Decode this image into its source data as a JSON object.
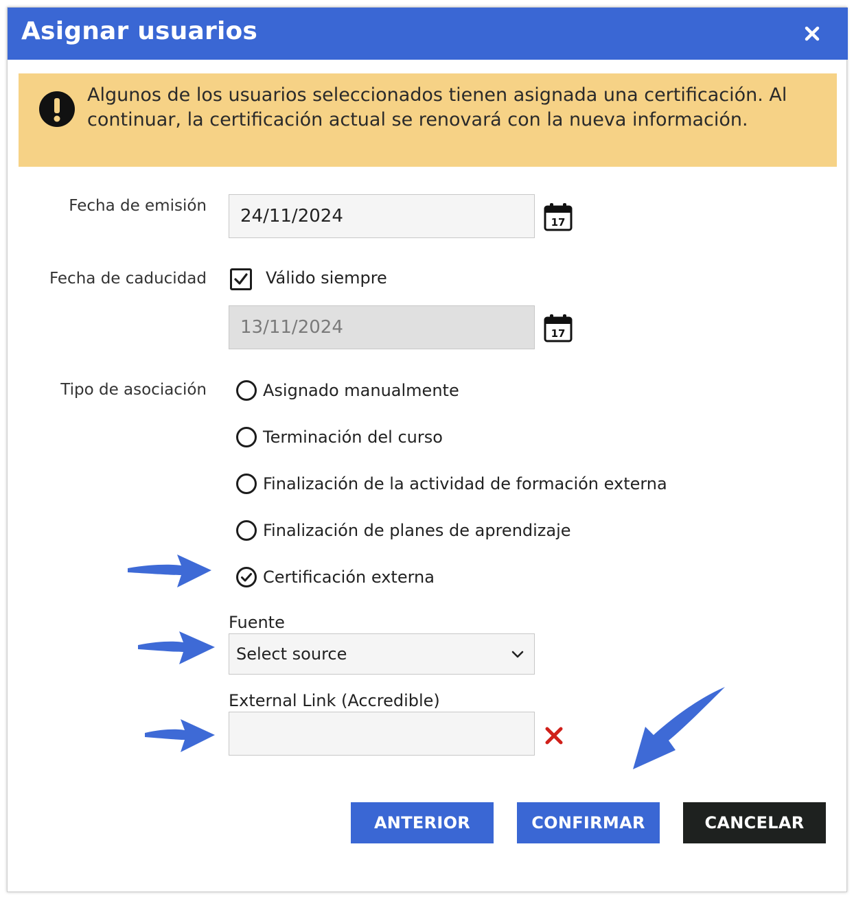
{
  "dialog": {
    "title": "Asignar usuarios",
    "close_icon": "close-icon"
  },
  "warning": {
    "icon": "exclamation-circle-icon",
    "text": "Algunos de los usuarios seleccionados tienen asignada una certificación. Al continuar, la certificación actual se renovará con la nueva información."
  },
  "form": {
    "issue_date": {
      "label": "Fecha de emisión",
      "value": "24/11/2024",
      "icon": "calendar-icon"
    },
    "expiry_date": {
      "label": "Fecha de caducidad",
      "always_valid_label": "Válido siempre",
      "always_valid_checked": true,
      "value": "13/11/2024",
      "icon": "calendar-icon"
    },
    "association": {
      "label": "Tipo de asociación",
      "options": [
        {
          "label": "Asignado manualmente",
          "selected": false
        },
        {
          "label": "Terminación del curso",
          "selected": false
        },
        {
          "label": "Finalización de la actividad de formación externa",
          "selected": false
        },
        {
          "label": "Finalización de planes de aprendizaje",
          "selected": false
        },
        {
          "label": "Certificación externa",
          "selected": true
        }
      ]
    },
    "source": {
      "label": "Fuente",
      "selected": "Select source"
    },
    "external_link": {
      "label": "External Link (Accredible)",
      "value": ""
    }
  },
  "buttons": {
    "previous": "ANTERIOR",
    "confirm": "CONFIRMAR",
    "cancel": "CANCELAR"
  },
  "colors": {
    "header": "#3a67d4",
    "warning_bg": "#f6d286",
    "primary_button": "#3a67d4",
    "cancel_button": "#1e211f",
    "annotation_arrow": "#3e6ad6",
    "clear_icon": "#d0201a"
  }
}
